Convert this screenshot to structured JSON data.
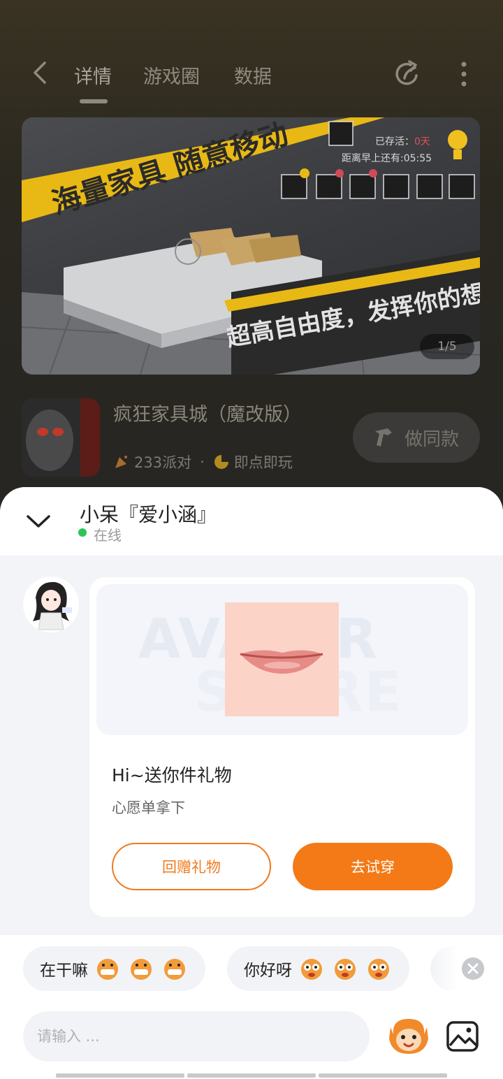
{
  "header": {
    "tabs": [
      {
        "label": "详情",
        "active": true
      },
      {
        "label": "游戏圈",
        "active": false
      },
      {
        "label": "数据",
        "active": false
      }
    ]
  },
  "banner": {
    "overlay_top": "海量家具 随意移动",
    "overlay_bottom": "超高自由度，发挥你的想象！",
    "hud_survived_label": "已存活：",
    "hud_survived_value": "0天",
    "hud_countdown_label": "距离早上还有:",
    "hud_countdown_value": "05:55",
    "pager": "1/5"
  },
  "game": {
    "title": "疯狂家具城（魔改版）",
    "party_count": "233派对",
    "play_mode": "即点即玩",
    "same_button": "做同款"
  },
  "chat": {
    "contact_name": "小呆『爱小涵』",
    "status": "在线",
    "gift": {
      "watermark_line1": "AVATAR",
      "watermark_line2": "STORE",
      "title": "Hi~送你件礼物",
      "subtitle": "心愿单拿下",
      "return_button": "回赠礼物",
      "try_button": "去试穿"
    },
    "quick_replies": [
      {
        "text": "在干嘛"
      },
      {
        "text": "你好呀"
      }
    ],
    "input_placeholder": "请输入 ..."
  },
  "colors": {
    "accent": "#f37a17",
    "online": "#2fc25b",
    "sheet_bg": "#f2f4f7"
  }
}
